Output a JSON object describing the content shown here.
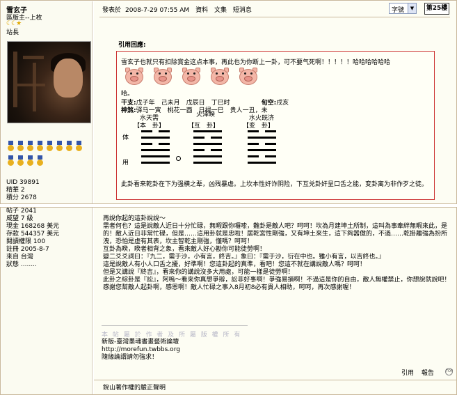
{
  "post": {
    "author": {
      "name": "雪玄子",
      "title": "區版主--上枚",
      "stars": "☾☾★",
      "rank": "站長",
      "stats": [
        {
          "label": "UID",
          "value": "39891"
        },
        {
          "label": "精華",
          "value": "2"
        },
        {
          "label": "積分",
          "value": "2678"
        }
      ]
    },
    "meta": {
      "posted_label": "發表於",
      "posted_time": "2008-7-29 07:55 AM",
      "profile_link": "資料",
      "collection_link": "文集",
      "message_link": "短消息"
    },
    "font_select": {
      "value": "字號",
      "arrow": "▼"
    },
    "floor": "第25樓",
    "quote": {
      "label": "引用回應:",
      "line1": "雪玄子也就只有扣除賞金这点本事，再此也为你断上一卦，可不要气死啊！！！！！哈哈哈哈哈哈",
      "ha": "哈。",
      "row_gan_label": "干支:",
      "row_gan": "戊子年　己未月　戊辰日　丁巳时　　　　　",
      "row_kong_label": "旬空:",
      "row_kong": "戌亥",
      "row_shen_label": "神煞:",
      "row_shen": "驿马一寅　桃花一酉　日禄一巳　贵人一丑，未",
      "gua_names": [
        "水天需",
        "火泽睽",
        "水火既济"
      ],
      "gua_heads": [
        "【本　卦】",
        "【互　卦】",
        "【变　卦】"
      ],
      "side_ti": "体",
      "side_yong": "用",
      "footer": "此卦看来乾卦在下为强横之辈，凶残暴虐。上坎本性奸诈阴险，下互兑卦奸呈口舌之能，变卦离为非作歹之徒。"
    }
  },
  "post2": {
    "author_stats": [
      {
        "label": "帖子",
        "value": "2041"
      },
      {
        "label": "威望",
        "value": "7 級"
      },
      {
        "label": "現金",
        "value": "168268 美元"
      },
      {
        "label": "存款",
        "value": "544357 美元"
      },
      {
        "label": "閱讀權限",
        "value": "100"
      },
      {
        "label": "註冊",
        "value": "2005-8-7"
      },
      {
        "label": "來自",
        "value": "台灣"
      },
      {
        "label": "狀態",
        "value": "........"
      }
    ],
    "body": [
      "再說你起的這卦說說～",
      "需者何也？這是說敵人近日十分忙碌，無暇跟你囉嗦，難卦是敵人吧？呵呵！坎為月建坤土所制，這叫為事牽絆無暇來此，是的！敵人近日非常忙碌，但是……這用卦就是忠啦！居乾宮性剛強，又有坤土來生，這下夠嚣傲的，不過……乾掛離強為扮所洩，恐怕是虛有其表，坎主智乾主剛強，懂嗎？呵呵！",
      "互卦為睽，睽者相背之象，看來敵人好心勸你可能徒勞啊！",
      "變二爻爻詞曰：『九二，需于沙，小有言，終吉。』象曰：『需于沙，衍在中也。雖小有言，以吉終也。』",
      "這是說敵人有小人口舌之擾，好準啊！您這卦起的真準，看吧！您這不就在講說敵人嗎？呵呵！",
      "但是又講說『終吉』，看來你的講說沒多大用處，可能一樣是徒勞啊！",
      "此卦之綜卦是『訟』，阿嗚～看來你真想爭辯，訟非好事啊！爭強易損啊！不過這是你的自由，敵人無權禁止，你想說就說吧！",
      "感謝您幫敵人起卦啊，感恩啊！敵人忙碌之事入8月初8必有貴人相助，呵呵，再次感謝喔！"
    ],
    "signature_faint": "本 帖 屬 於 作 者 及 所 屬 版 權 所 有",
    "signature": [
      "新版-臺灣墨魂書畫藝術論壇",
      "http://morefun.twbbs.org",
      "隨緣論謂請勿強求！"
    ],
    "actions": {
      "quote": "引用",
      "report": "報告",
      "top": "TOP"
    },
    "footer": "銳山著作權的嚴正聲明"
  },
  "hexagrams": [
    {
      "name": "水天需",
      "lines": [
        "yin",
        "yang",
        "yin",
        "yang",
        "yang",
        "yang"
      ]
    },
    {
      "name": "火泽睽",
      "lines": [
        "yang",
        "yin",
        "yang",
        "yin",
        "yang",
        "yang"
      ]
    },
    {
      "name": "水火既济",
      "lines": [
        "yin",
        "yang",
        "yin",
        "yang",
        "yin",
        "yang"
      ]
    }
  ],
  "colors": {
    "accent_border": "#cc3333",
    "panel_bg": "#fdfdf3",
    "sidebar_bg": "#fbfbf1"
  }
}
